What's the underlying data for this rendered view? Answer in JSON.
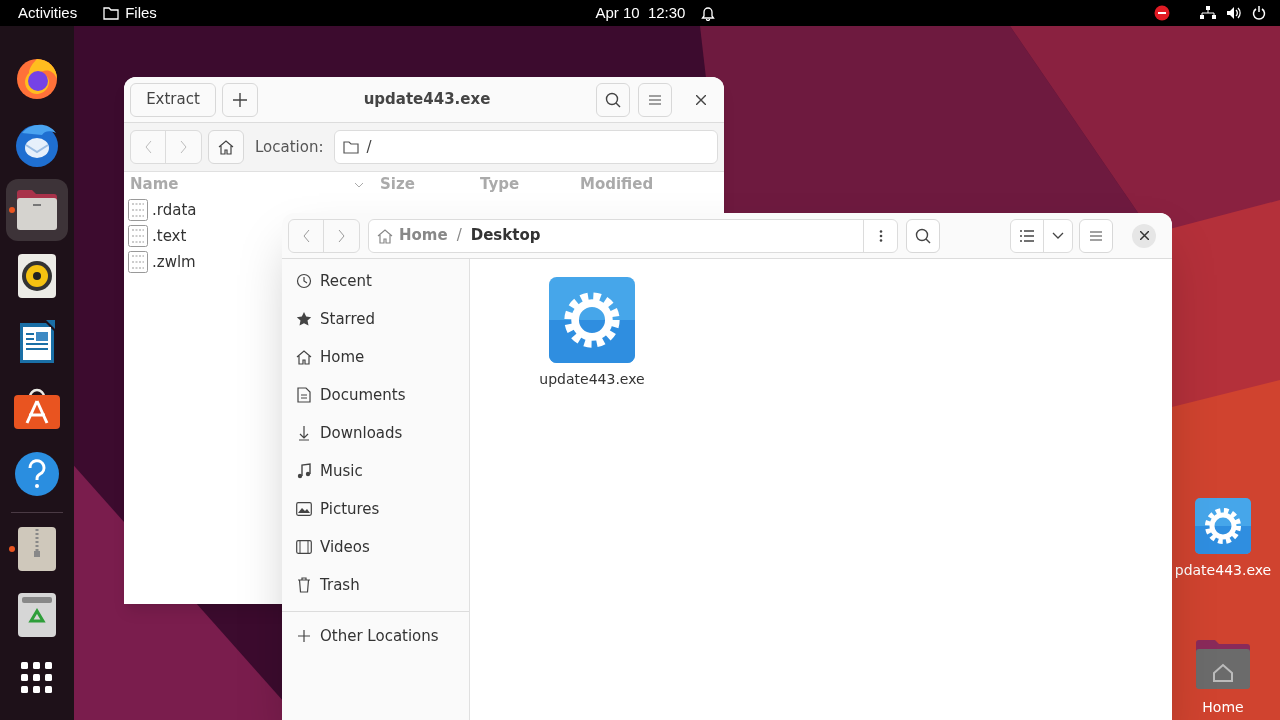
{
  "top_bar": {
    "activities": "Activities",
    "app": "Files",
    "clock": "Apr 10  12:30"
  },
  "dock": {
    "items": [
      {
        "running": false,
        "selected": false
      },
      {
        "running": false,
        "selected": false
      },
      {
        "running": true,
        "selected": true
      },
      {
        "running": false,
        "selected": false
      },
      {
        "running": false,
        "selected": false
      },
      {
        "running": false,
        "selected": false
      },
      {
        "running": false,
        "selected": false
      },
      {
        "running": true,
        "selected": false
      },
      {
        "running": false,
        "selected": false
      }
    ]
  },
  "archive_window": {
    "title": "update443.exe",
    "extract_button": "Extract",
    "location_label": "Location:",
    "location": "/",
    "columns": [
      "Name",
      "Size",
      "Type",
      "Modified"
    ],
    "rows": [
      {
        "name": ".rdata"
      },
      {
        "name": ".text"
      },
      {
        "name": ".zwlm"
      }
    ]
  },
  "files_window": {
    "path_separator": "/",
    "path": [
      {
        "label": "Home",
        "current": false
      },
      {
        "label": "Desktop",
        "current": true
      }
    ],
    "sidebar": {
      "items": [
        {
          "label": "Recent",
          "selected": false
        },
        {
          "label": "Starred",
          "selected": false
        },
        {
          "label": "Home",
          "selected": false
        },
        {
          "label": "Documents",
          "selected": false
        },
        {
          "label": "Downloads",
          "selected": false
        },
        {
          "label": "Music",
          "selected": false
        },
        {
          "label": "Pictures",
          "selected": false
        },
        {
          "label": "Videos",
          "selected": false
        },
        {
          "label": "Trash",
          "selected": false
        }
      ],
      "other_locations": "Other Locations"
    },
    "files": [
      {
        "name": "update443.exe",
        "kind": "executable",
        "selected": false
      }
    ]
  },
  "desktop_icons": [
    {
      "label": "pdate443.exe",
      "kind": "executable"
    },
    {
      "label": "Home",
      "kind": "folder"
    }
  ]
}
